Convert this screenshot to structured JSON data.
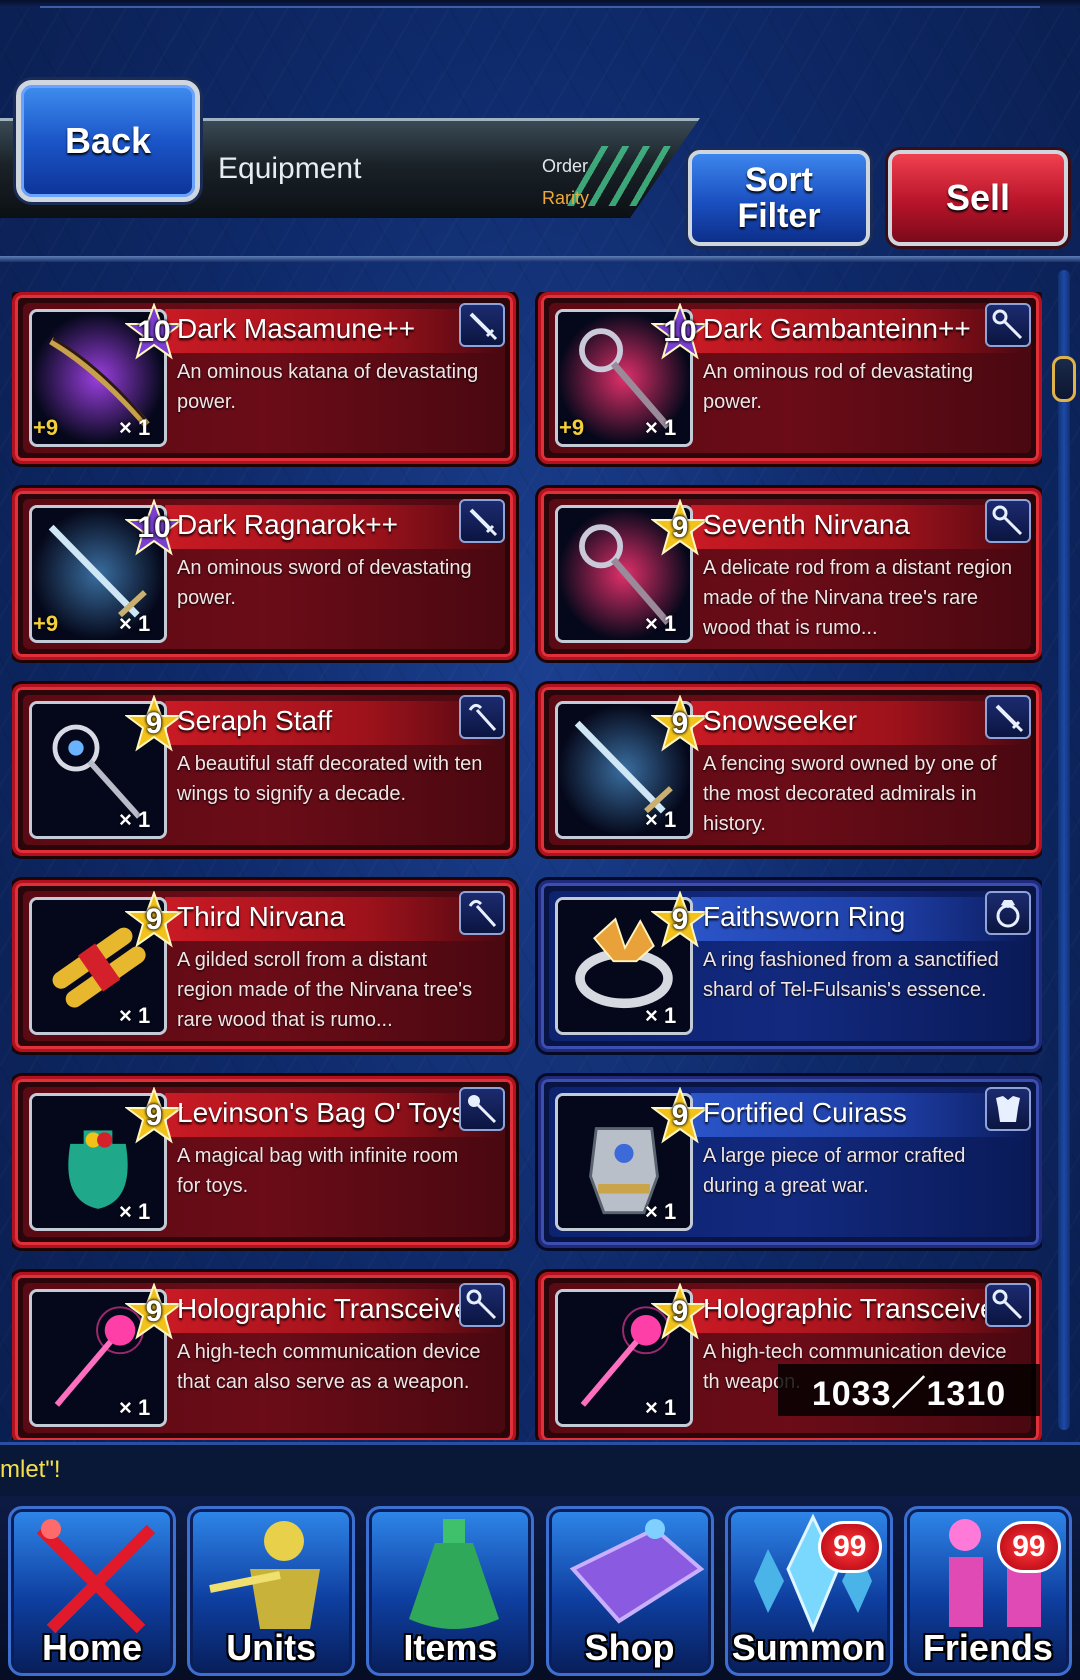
{
  "header": {
    "back_label": "Back",
    "title": "Equipment",
    "order_label": "Order",
    "order_value": "Rarity",
    "sort_line1": "Sort",
    "sort_line2": "Filter",
    "sell_label": "Sell"
  },
  "items": [
    {
      "name": "Dark Masamune++",
      "desc": "An ominous katana of devastating power.",
      "rarity": "10",
      "plus": "+9",
      "count": "× 1",
      "type_icon": "sword-icon",
      "frame": "red",
      "art": "katana-art"
    },
    {
      "name": "Dark Gambanteinn++",
      "desc": "An ominous rod of devastating power.",
      "rarity": "10",
      "plus": "+9",
      "count": "× 1",
      "type_icon": "rod-icon",
      "frame": "red",
      "art": "rod-art"
    },
    {
      "name": "Dark Ragnarok++",
      "desc": "An ominous sword of devastating power.",
      "rarity": "10",
      "plus": "+9",
      "count": "× 1",
      "type_icon": "sword-icon",
      "frame": "red",
      "art": "sword-art"
    },
    {
      "name": "Seventh Nirvana",
      "desc": "A delicate rod from a distant region made of the Nirvana tree's rare wood that is rumo...",
      "rarity": "9",
      "plus": "",
      "count": "× 1",
      "type_icon": "rod-icon",
      "frame": "red",
      "art": "rod-art"
    },
    {
      "name": "Seraph Staff",
      "desc": "A beautiful staff decorated with ten wings to signify a decade.",
      "rarity": "9",
      "plus": "",
      "count": "× 1",
      "type_icon": "staff-icon",
      "frame": "red",
      "art": "staff-art"
    },
    {
      "name": "Snowseeker",
      "desc": "A fencing sword owned by one of the most decorated admirals in history.",
      "rarity": "9",
      "plus": "",
      "count": "× 1",
      "type_icon": "sword-icon",
      "frame": "red",
      "art": "sword-art"
    },
    {
      "name": "Third Nirvana",
      "desc": "A gilded scroll from a distant region made of the Nirvana tree's rare wood that is rumo...",
      "rarity": "9",
      "plus": "",
      "count": "× 1",
      "type_icon": "staff-icon",
      "frame": "red",
      "art": "scroll-art"
    },
    {
      "name": "Faithsworn Ring",
      "desc": "A ring fashioned from a sanctified shard of Tel-Fulsanis's essence.",
      "rarity": "9",
      "plus": "",
      "count": "× 1",
      "type_icon": "ring-icon",
      "frame": "blue",
      "art": "ring-art"
    },
    {
      "name": "Levinson's Bag O' Toys",
      "desc": "A magical bag with infinite room for toys.",
      "rarity": "9",
      "plus": "",
      "count": "× 1",
      "type_icon": "mace-icon",
      "frame": "red",
      "art": "bag-art"
    },
    {
      "name": "Fortified Cuirass",
      "desc": "A large piece of armor crafted during a great war.",
      "rarity": "9",
      "plus": "",
      "count": "× 1",
      "type_icon": "armor-icon",
      "frame": "blue",
      "art": "armor-art"
    },
    {
      "name": "Holographic Transceiver",
      "desc": "A high-tech communication device that can also serve as a weapon.",
      "rarity": "9",
      "plus": "",
      "count": "× 1",
      "type_icon": "rod-icon",
      "frame": "red",
      "art": "transceiver-art"
    },
    {
      "name": "Holographic Transceiver",
      "desc": "A high-tech communication device th weapon.",
      "rarity": "9",
      "plus": "",
      "count": "× 1",
      "type_icon": "rod-icon",
      "frame": "red",
      "art": "transceiver-art"
    }
  ],
  "counter": "1033／1310",
  "ticker": "mlet\"!",
  "nav": [
    {
      "label": "Home",
      "icon": "home-swords-icon",
      "badge": ""
    },
    {
      "label": "Units",
      "icon": "units-warrior-icon",
      "badge": ""
    },
    {
      "label": "Items",
      "icon": "items-potion-icon",
      "badge": ""
    },
    {
      "label": "Shop",
      "icon": "shop-chest-icon",
      "badge": ""
    },
    {
      "label": "Summon",
      "icon": "summon-crystal-icon",
      "badge": "99"
    },
    {
      "label": "Friends",
      "icon": "friends-icon",
      "badge": "99"
    }
  ],
  "colors": {
    "red_frame": "#b2121f",
    "blue_frame": "#1f2a7a",
    "gold_star": "#f2c21a",
    "purple_star": "#7a3fd0",
    "plus_text": "#f4cf3a"
  }
}
